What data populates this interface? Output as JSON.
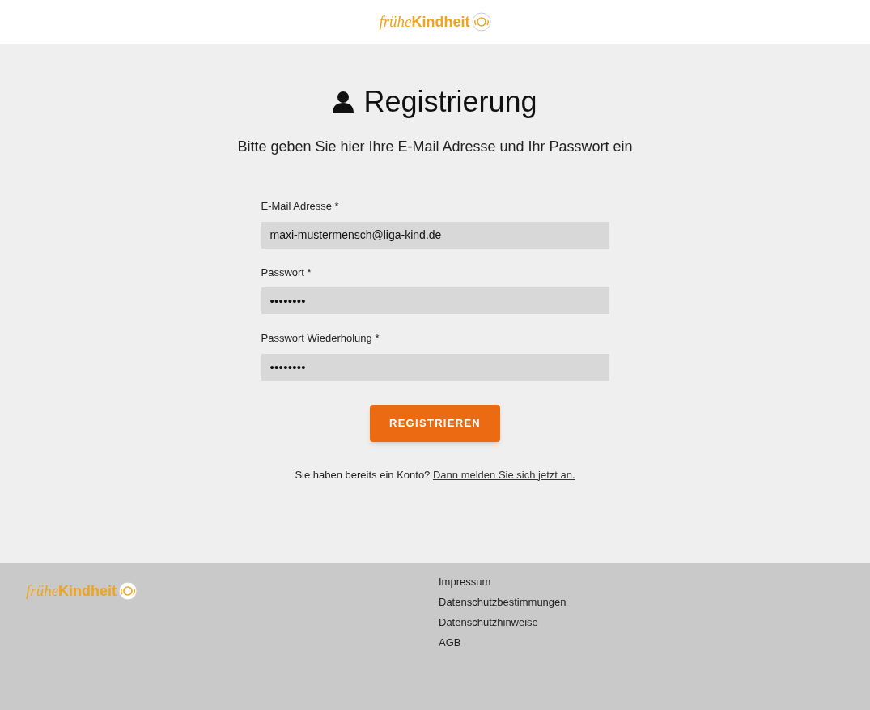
{
  "header": {
    "logo": {
      "word_1": "frühe",
      "word_2": "Kindheit"
    }
  },
  "title": "Registrierung",
  "subtitle": "Bitte geben Sie hier Ihre E-Mail Adresse und Ihr Passwort ein",
  "fields": [
    {
      "label": "E-Mail Adresse",
      "required_mark": "*",
      "value": "maxi-mustermensch@liga-kind.de",
      "kind": "text"
    },
    {
      "label": "Passwort",
      "required_mark": "*",
      "value": "••••••••",
      "kind": "masked"
    },
    {
      "label": "Passwort Wiederholung",
      "required_mark": "*",
      "value": "••••••••",
      "kind": "masked"
    }
  ],
  "submit_button": "REGISTRIEREN",
  "login_prompt": {
    "text": "Sie haben bereits ein Konto?",
    "link": "Dann melden Sie sich jetzt an."
  },
  "footer": {
    "logo": {
      "word_1": "frühe",
      "word_2": "Kindheit"
    },
    "links": [
      "Impressum",
      "Datenschutzbestimmungen",
      "Datenschutzhinweise",
      "AGB"
    ]
  }
}
